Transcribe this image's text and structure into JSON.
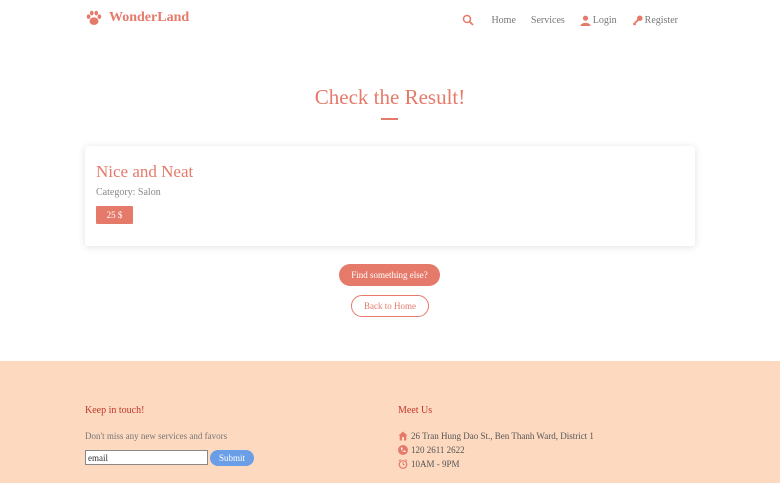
{
  "header": {
    "brand": "WonderLand",
    "nav": {
      "home": "Home",
      "services": "Services",
      "login": "Login",
      "register": "Register"
    }
  },
  "main": {
    "title": "Check the Result!",
    "result": {
      "name": "Nice and Neat",
      "category": "Category: Salon",
      "price": "25 $"
    },
    "find_button": "Find something else?",
    "home_button": "Back to Home"
  },
  "footer": {
    "keep_title": "Keep in touch!",
    "keep_desc": "Don't miss any new services and favors",
    "email_value": "email",
    "submit_label": "Submit",
    "meet_title": "Meet Us",
    "address": "26 Tran Hung Dao St., Ben Thanh Ward, District 1",
    "phone": "120 2611 2622",
    "hours": "10AM - 9PM"
  },
  "colors": {
    "accent": "#e57a6a",
    "footer_bg": "#fdd9c0",
    "submit": "#6a9ee6"
  },
  "icons": [
    "paw-icon",
    "search-icon",
    "user-icon",
    "key-icon",
    "home-icon",
    "phone-icon",
    "clock-icon"
  ]
}
